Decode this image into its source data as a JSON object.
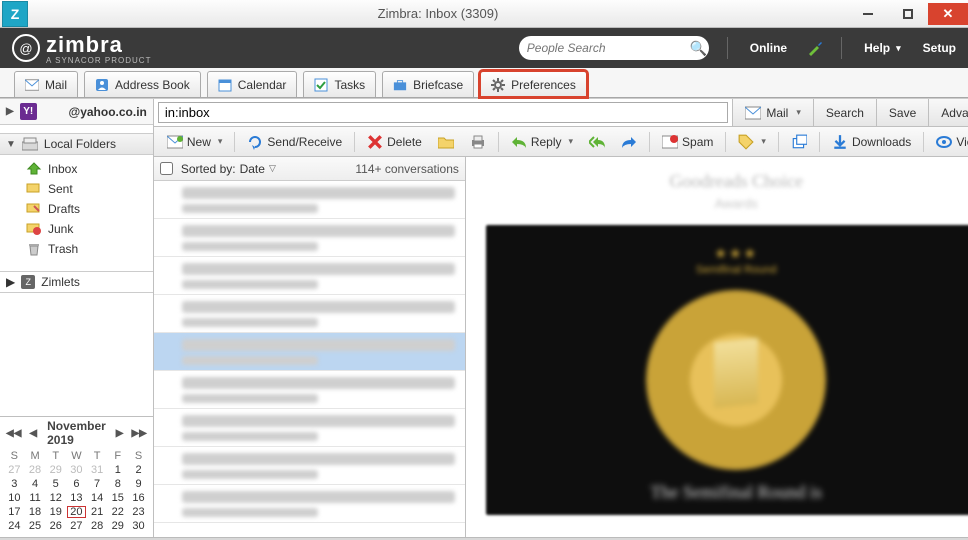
{
  "window": {
    "title": "Zimbra: Inbox (3309)"
  },
  "brand": {
    "name": "zimbra",
    "sub": "A SYNACOR PRODUCT"
  },
  "header": {
    "search_placeholder": "People Search",
    "online": "Online",
    "help": "Help",
    "setup": "Setup"
  },
  "tabs": {
    "mail": "Mail",
    "addressbook": "Address Book",
    "calendar": "Calendar",
    "tasks": "Tasks",
    "briefcase": "Briefcase",
    "preferences": "Preferences"
  },
  "account": {
    "suffix": "@yahoo.co.in"
  },
  "folders": {
    "header": "Local Folders",
    "inbox": "Inbox",
    "sent": "Sent",
    "drafts": "Drafts",
    "junk": "Junk",
    "trash": "Trash"
  },
  "zimlets": "Zimlets",
  "calendar": {
    "month": "November 2019",
    "dow": [
      "S",
      "M",
      "T",
      "W",
      "T",
      "F",
      "S"
    ],
    "rows": [
      [
        "27",
        "28",
        "29",
        "30",
        "31",
        "1",
        "2"
      ],
      [
        "3",
        "4",
        "5",
        "6",
        "7",
        "8",
        "9"
      ],
      [
        "10",
        "11",
        "12",
        "13",
        "14",
        "15",
        "16"
      ],
      [
        "17",
        "18",
        "19",
        "20",
        "21",
        "22",
        "23"
      ],
      [
        "24",
        "25",
        "26",
        "27",
        "28",
        "29",
        "30"
      ]
    ],
    "today": "20"
  },
  "query": {
    "value": "in:inbox",
    "mailbtn": "Mail",
    "search": "Search",
    "save": "Save",
    "advanced": "Advanced"
  },
  "toolbar": {
    "new": "New",
    "sendrecv": "Send/Receive",
    "delete": "Delete",
    "reply": "Reply",
    "spam": "Spam",
    "downloads": "Downloads",
    "view": "View"
  },
  "list": {
    "sortlabel": "Sorted by:",
    "sortfield": "Date",
    "count": "114+ conversations"
  }
}
